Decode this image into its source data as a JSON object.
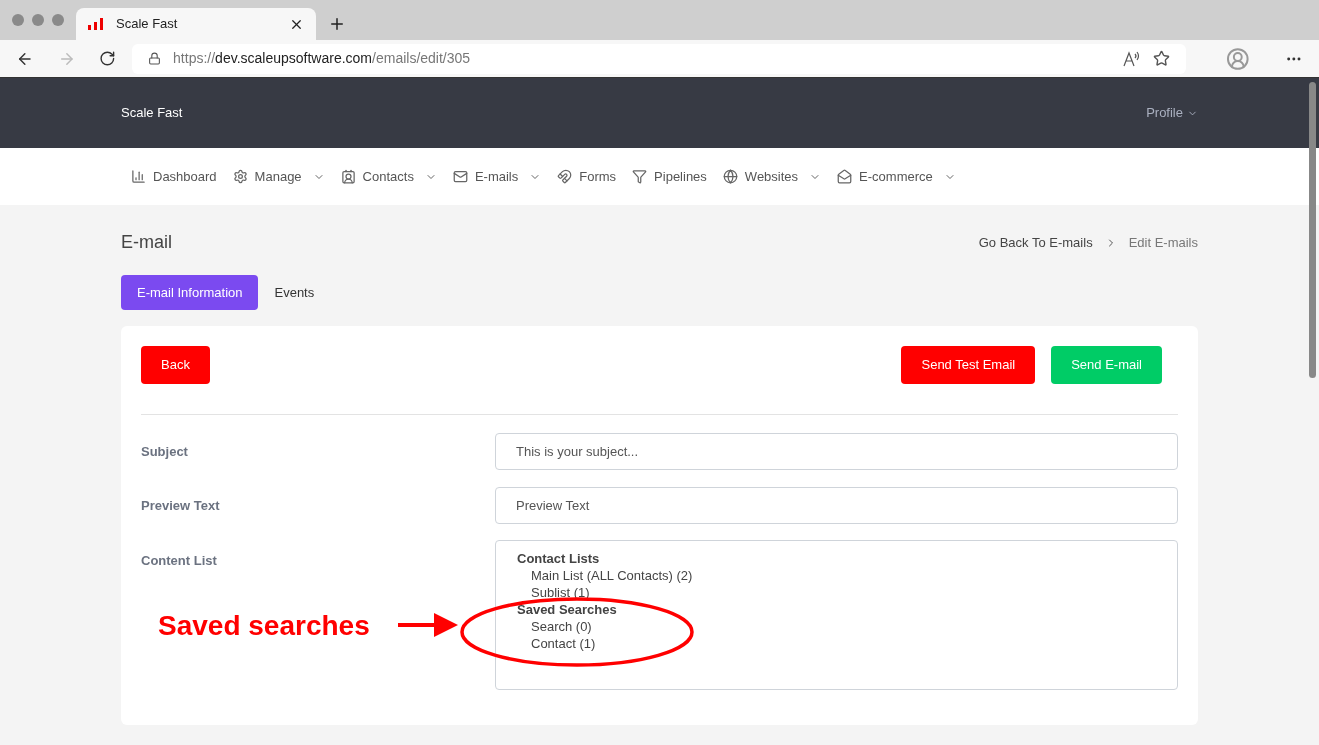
{
  "browser": {
    "tab_title": "Scale Fast",
    "url": [
      {
        "text": "https://",
        "strong": false
      },
      {
        "text": "dev.scaleupsoftware.com",
        "strong": true
      },
      {
        "text": "/emails/edit/305",
        "strong": false
      }
    ]
  },
  "header": {
    "brand": "Scale Fast",
    "profile": "Profile"
  },
  "nav": [
    {
      "label": "Dashboard",
      "dropdown": false
    },
    {
      "label": "Manage",
      "dropdown": true
    },
    {
      "label": "Contacts",
      "dropdown": true
    },
    {
      "label": "E-mails",
      "dropdown": true
    },
    {
      "label": "Forms",
      "dropdown": false
    },
    {
      "label": "Pipelines",
      "dropdown": false
    },
    {
      "label": "Websites",
      "dropdown": true
    },
    {
      "label": "E-commerce",
      "dropdown": true
    }
  ],
  "page": {
    "title": "E-mail",
    "breadcrumb": [
      {
        "label": "Go Back To E-mails",
        "link": true
      },
      {
        "label": "Edit E-mails",
        "link": false
      }
    ]
  },
  "tabs": [
    {
      "label": "E-mail Information",
      "selected": true
    },
    {
      "label": "Events",
      "selected": false
    }
  ],
  "actions": {
    "back": "Back",
    "send_test": "Send Test Email",
    "send": "Send E-mail"
  },
  "form": {
    "subject": {
      "label": "Subject",
      "placeholder": "This is your subject..."
    },
    "preview": {
      "label": "Preview Text",
      "placeholder": "Preview Text"
    },
    "content_list": {
      "label": "Content List",
      "items": [
        {
          "kind": "group",
          "text": "Contact Lists"
        },
        {
          "kind": "option",
          "text": "Main List (ALL Contacts) (2)"
        },
        {
          "kind": "option",
          "text": "Sublist (1)"
        },
        {
          "kind": "group",
          "text": "Saved Searches"
        },
        {
          "kind": "option",
          "text": "Search (0)"
        },
        {
          "kind": "option",
          "text": "Contact (1)"
        }
      ]
    }
  },
  "annotation": {
    "text": "Saved searches"
  }
}
